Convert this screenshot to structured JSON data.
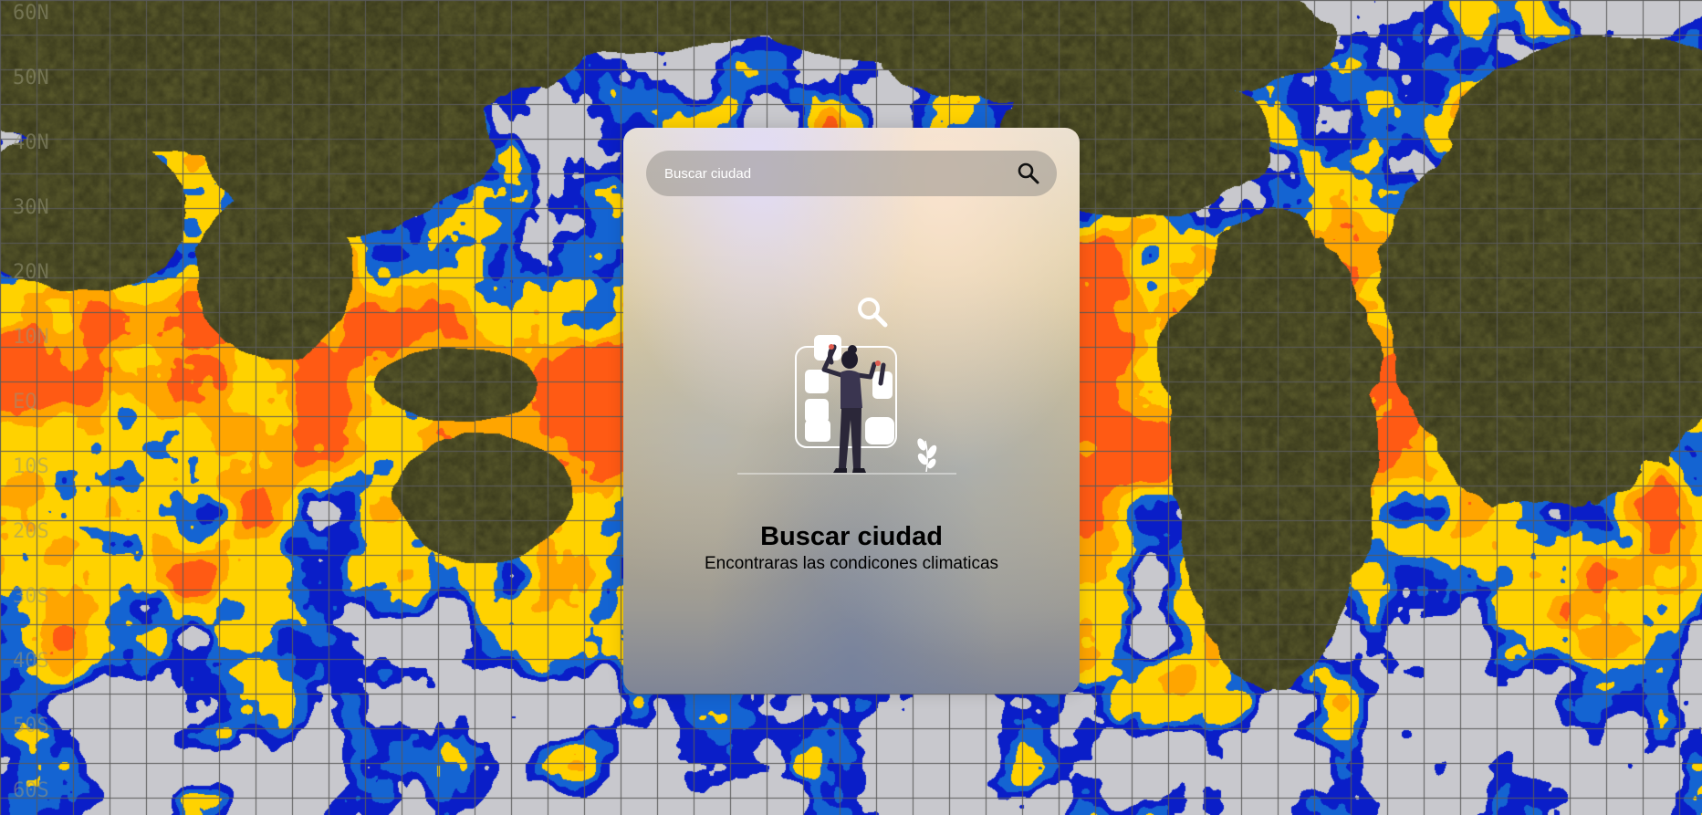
{
  "background": {
    "lat_labels": [
      "60N",
      "50N",
      "40N",
      "30N",
      "20N",
      "10N",
      "EQ",
      "10S",
      "20S",
      "30S",
      "40S",
      "50S",
      "60S"
    ]
  },
  "search": {
    "placeholder": "Buscar ciudad",
    "button_icon": "search-icon"
  },
  "empty_state": {
    "illustration": "person-searching-illustration",
    "title": "Buscar ciudad",
    "subtitle": "Encontraras las condicones climaticas"
  },
  "colors": {
    "land": "#4a4a24",
    "grid": "#5a5a5a",
    "text": "#000000",
    "search_text": "#ffffff"
  }
}
